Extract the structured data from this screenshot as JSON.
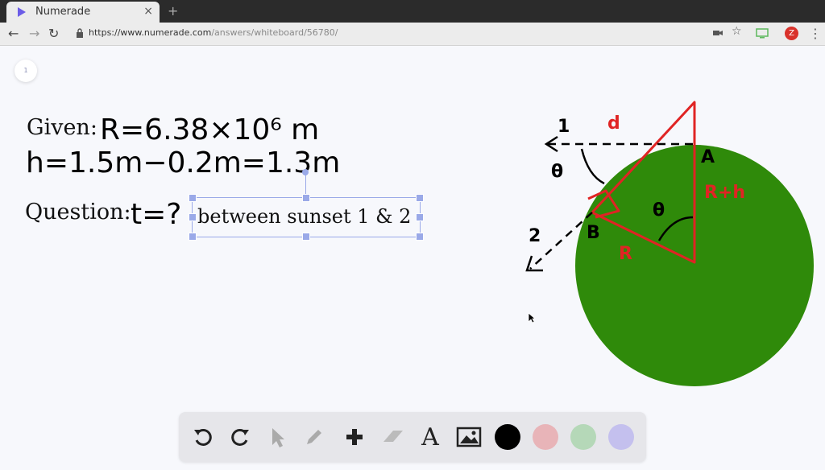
{
  "browser": {
    "tab_title": "Numerade",
    "tab_close": "×",
    "new_tab": "+",
    "url_host": "https://www.numerade.com",
    "url_path": "/answers/whiteboard/56780/",
    "avatar_letter": "Z"
  },
  "page_indicator": "1",
  "whiteboard": {
    "given_label": "Given:",
    "given_value": "R=6.38×10⁶ m",
    "h_value": "h=1.5m−0.2m=1.3m",
    "question_label": "Question:",
    "question_value": "t=?",
    "textbox_text": "between sunset 1 & 2"
  },
  "diagram": {
    "label_1": "1",
    "label_2": "2",
    "label_d": "d",
    "label_A": "A",
    "label_B": "B",
    "label_R": "R",
    "label_Rh": "R+h",
    "label_theta_1": "θ",
    "label_theta_2": "θ",
    "earth_color": "#2f8a0a",
    "line_color": "#e02424"
  },
  "toolbar": {
    "tools": [
      "undo-icon",
      "redo-icon",
      "select-icon",
      "pen-icon",
      "add-icon",
      "eraser-icon",
      "text-icon",
      "image-icon"
    ],
    "text_tool_glyph": "A",
    "colors": [
      "#000000",
      "#e8b4b8",
      "#b5d8b8",
      "#c4c0ee"
    ]
  }
}
